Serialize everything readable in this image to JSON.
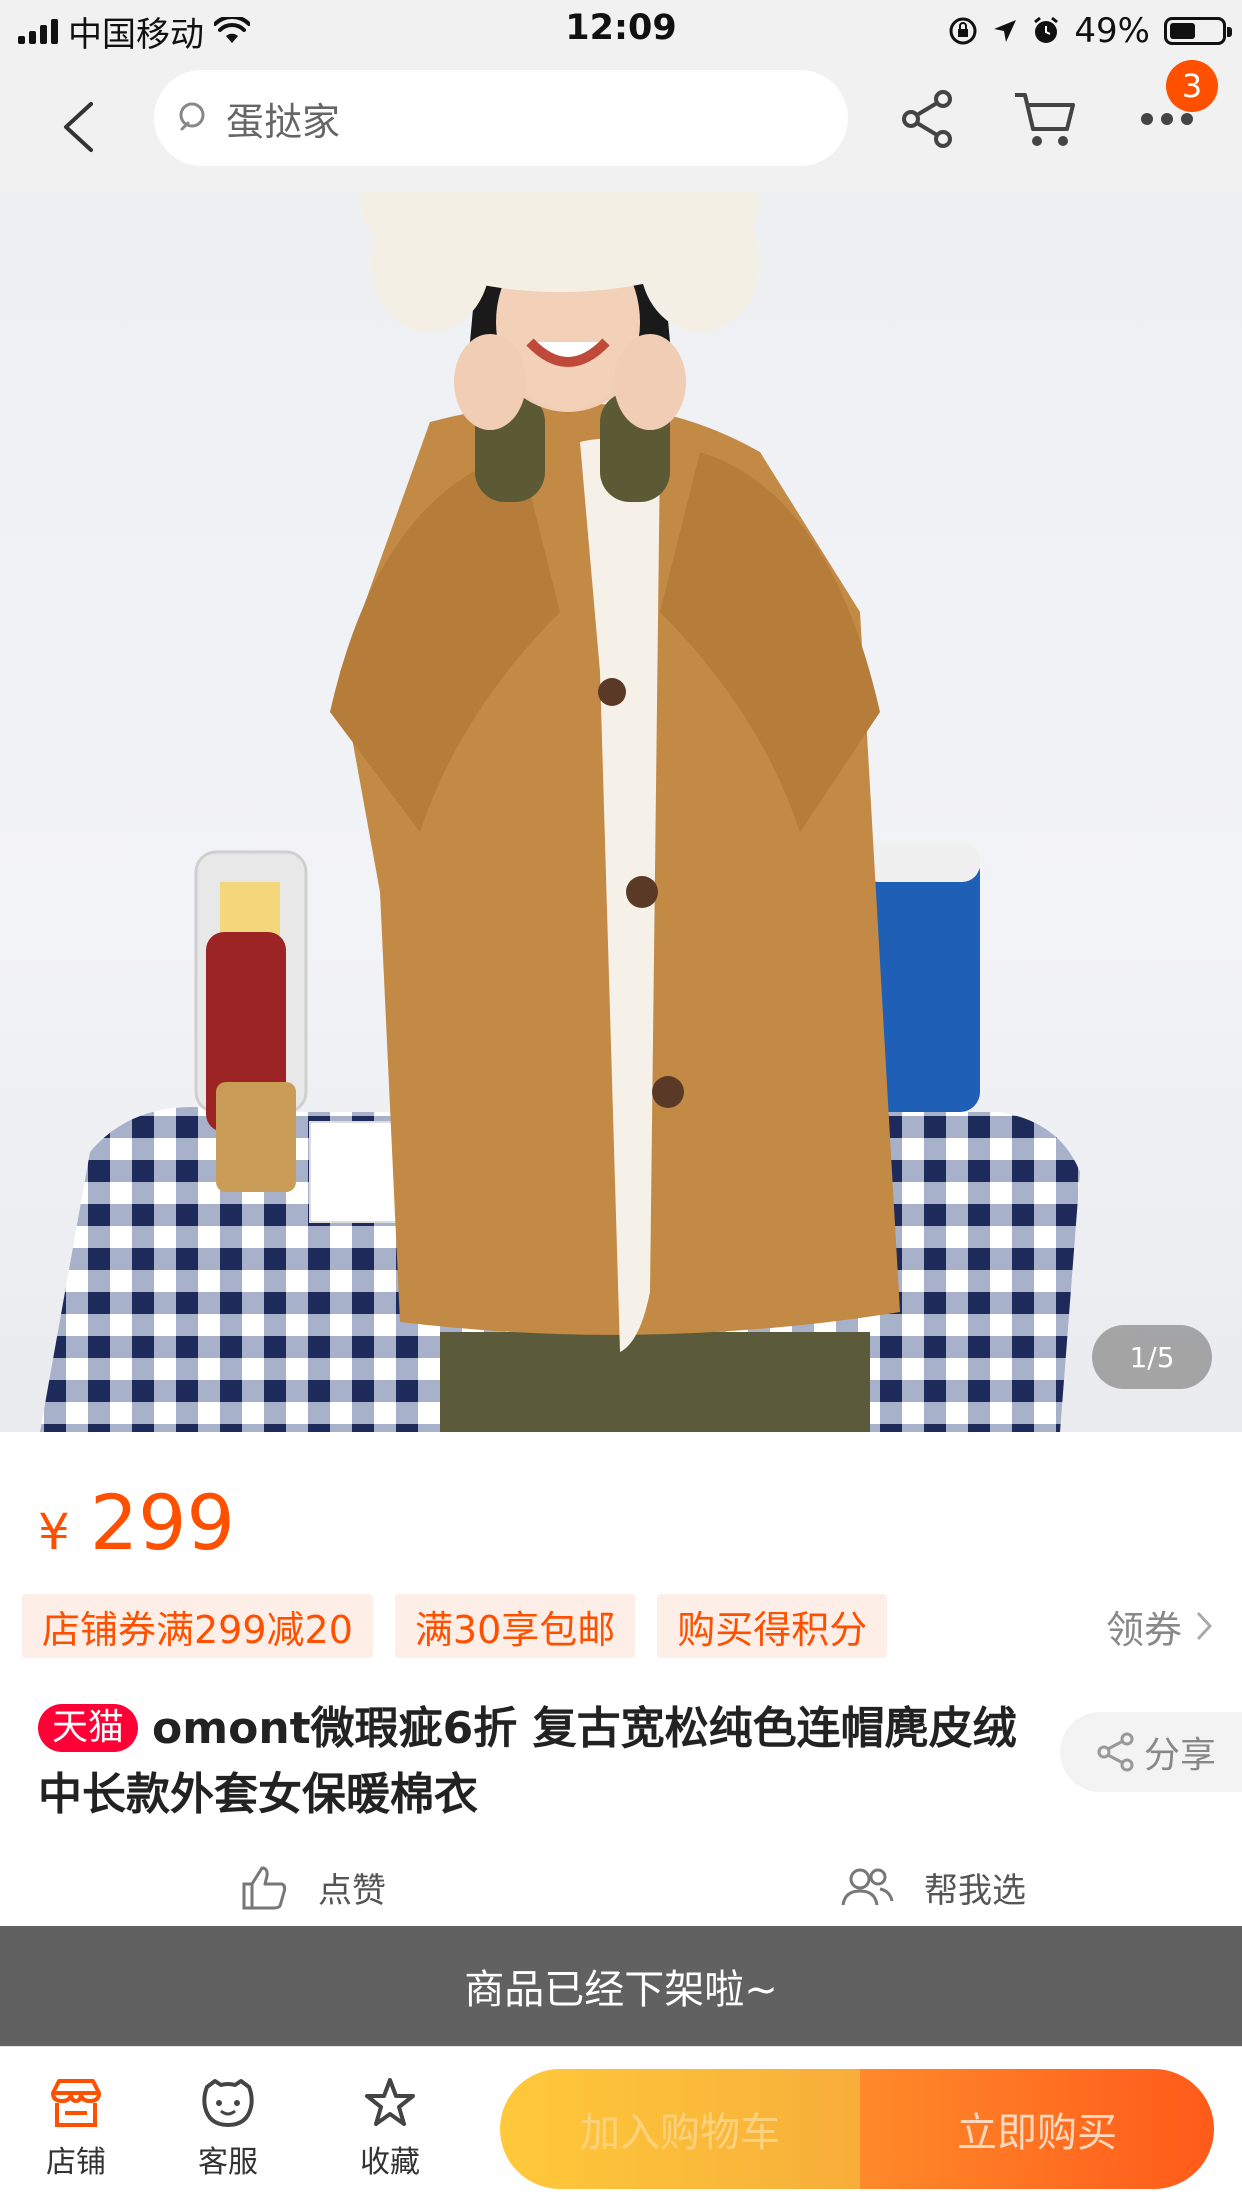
{
  "status_bar": {
    "carrier": "中国移动",
    "time": "12:09",
    "battery": "49%",
    "battery_level": 0.49
  },
  "nav": {
    "search_placeholder": "蛋挞家",
    "badge_count": "3"
  },
  "gallery": {
    "counter": "1/5"
  },
  "price": {
    "currency": "¥",
    "value": "299"
  },
  "promo": {
    "tags": [
      "店铺券满299减20",
      "满30享包邮",
      "购买得积分"
    ],
    "coupon_label": "领券"
  },
  "product": {
    "tmall_label": "天猫",
    "title": "omont微瑕疵6折 复古宽松纯色连帽麂皮绒中长款外套女保暖棉衣",
    "share_label": "分享"
  },
  "actions": {
    "like_label": "点赞",
    "help_label": "帮我选"
  },
  "notice": "商品已经下架啦~",
  "bottom_bar": {
    "store_label": "店铺",
    "service_label": "客服",
    "favorite_label": "收藏",
    "add_cart_label": "加入购物车",
    "buy_now_label": "立即购买"
  },
  "colors": {
    "accent": "#ff5000",
    "tmall": "#ff0036"
  }
}
